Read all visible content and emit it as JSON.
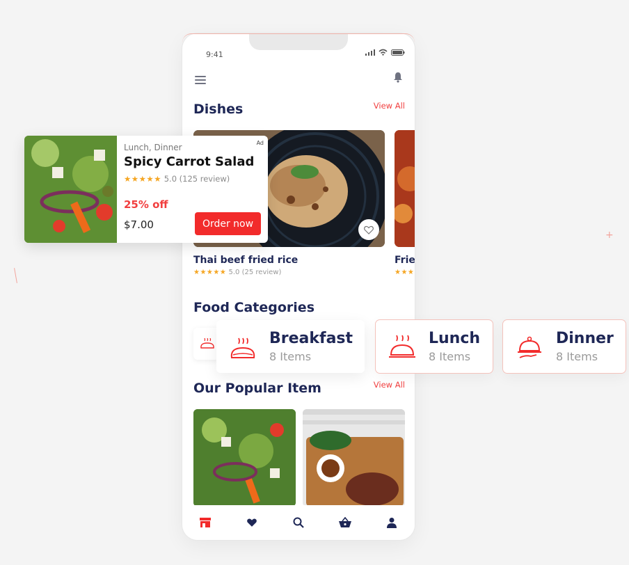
{
  "status": {
    "time": "9:41"
  },
  "dishes": {
    "title": "Dishes",
    "view_all": "View All",
    "items": [
      {
        "name": "Thai beef fried rice",
        "stars": "★★★★★",
        "rating": "5.0 (25 review)"
      },
      {
        "name": "Frie",
        "stars": "★★★"
      }
    ]
  },
  "categories": {
    "title": "Food Categories",
    "items": [
      {
        "name": "Breakfast",
        "count": "8 Items",
        "icon": "bread-icon"
      },
      {
        "name": "Lunch",
        "count": "8 Items",
        "icon": "hot-dish-icon"
      },
      {
        "name": "Dinner",
        "count": "8 Items",
        "icon": "cloche-icon"
      }
    ]
  },
  "popular": {
    "title": "Our Popular Item",
    "view_all": "View All"
  },
  "ad": {
    "tag": "Ad",
    "meta": "Lunch, Dinner",
    "title": "Spicy Carrot Salad",
    "stars": "★★★★★",
    "rating": "5.0 (125 review)",
    "discount": "25% off",
    "price": "$7.00",
    "cta": "Order now"
  },
  "nav": [
    "store-icon",
    "heart-icon",
    "search-icon",
    "basket-icon",
    "user-icon"
  ],
  "colors": {
    "accent": "#f22b2b",
    "heading": "#1e2756",
    "star": "#f5a623"
  }
}
